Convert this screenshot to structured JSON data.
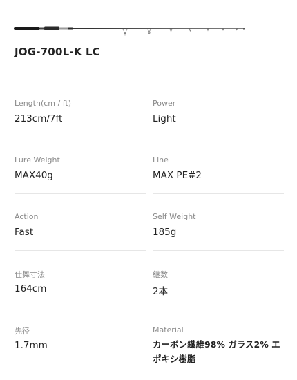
{
  "product": {
    "title": "JOG-700L-K LC"
  },
  "specs": [
    {
      "left": {
        "label": "Length(cm / ft)",
        "value": "213cm/7ft"
      },
      "right": {
        "label": "Power",
        "value": "Light"
      }
    },
    {
      "left": {
        "label": "Lure Weight",
        "value": "MAX40g"
      },
      "right": {
        "label": "Line",
        "value": "MAX PE#2"
      }
    },
    {
      "left": {
        "label": "Action",
        "value": "Fast"
      },
      "right": {
        "label": "Self Weight",
        "value": "185g"
      }
    },
    {
      "left": {
        "label": "仕舞寸法",
        "value": "164cm"
      },
      "right": {
        "label": "継数",
        "value": "2本"
      }
    },
    {
      "left": {
        "label": "先径",
        "value": "1.7mm"
      },
      "right": {
        "label": "Material",
        "value": "カーボン繊維98% ガラス2% エポキシ樹脂"
      }
    }
  ]
}
